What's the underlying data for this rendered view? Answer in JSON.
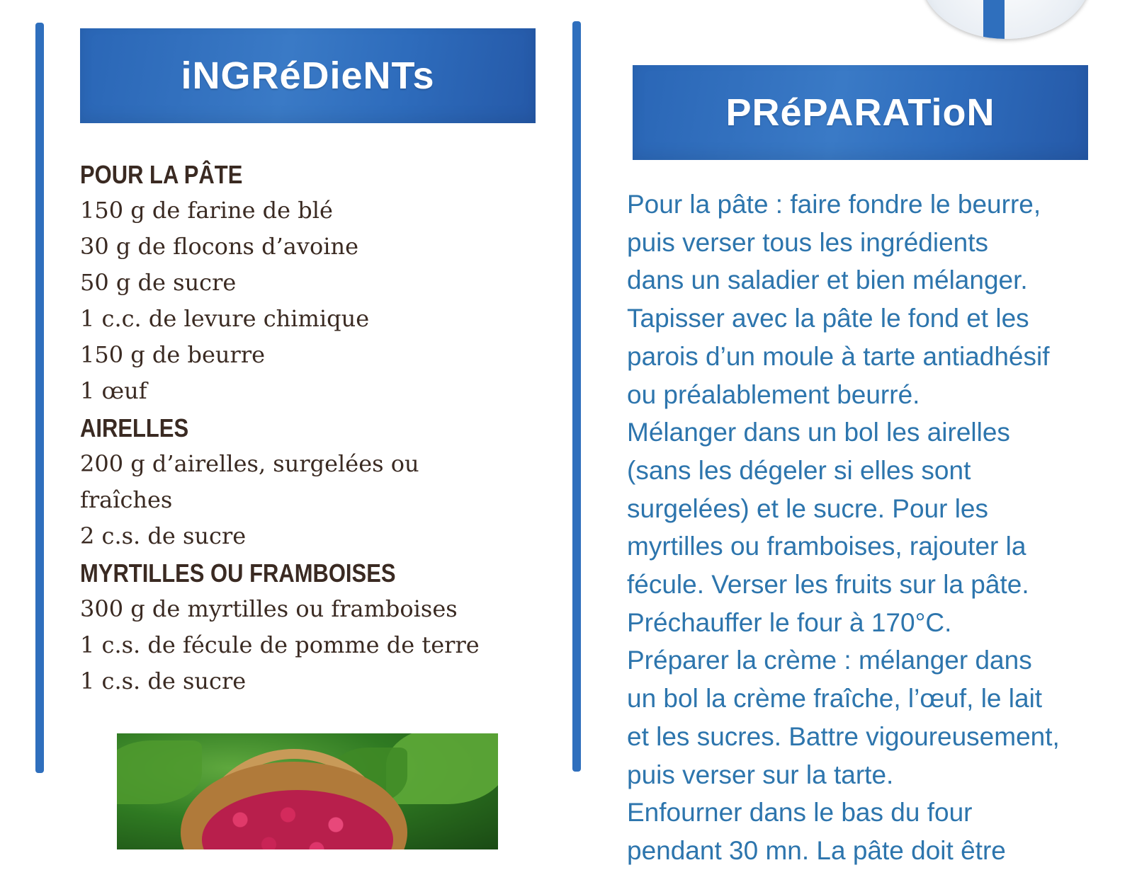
{
  "ingredients_banner": "iNGRéDieNTs",
  "preparation_banner": "PRéPARATioN",
  "ingredients": [
    {
      "title": "POUR LA PÂTE",
      "items": [
        "150 g de farine de blé",
        "30 g de flocons d’avoine",
        "50 g de sucre",
        "1 c.c. de levure chimique",
        "150 g de beurre",
        "1 œuf"
      ]
    },
    {
      "title": "AIRELLES",
      "items": [
        "200 g d’airelles, surgelées ou",
        "fraîches",
        "2 c.s. de sucre"
      ]
    },
    {
      "title": "MYRTILLES OU FRAMBOISES",
      "items": [
        "300 g de myrtilles ou framboises",
        "1 c.s. de fécule de pomme de terre",
        "1 c.s. de sucre"
      ]
    }
  ],
  "preparation_lines": [
    "Pour la pâte : faire fondre le beurre,",
    "puis verser tous les ingrédients",
    "dans un saladier et bien mélanger.",
    "Tapisser avec la pâte le fond et les",
    "parois d’un moule à tarte antiadhésif",
    "ou préalablement beurré.",
    "Mélanger dans un bol les airelles",
    "(sans les dégeler si elles sont",
    "surgelées) et le sucre. Pour les",
    "myrtilles ou framboises, rajouter la",
    "fécule. Verser les fruits sur la pâte.",
    "Préchauffer le four à 170°C.",
    "Préparer la crème : mélanger dans",
    "un bol la crème fraîche, l’œuf, le lait",
    "et les sucres. Battre vigoureusement,",
    "puis verser sur la tarte.",
    "Enfourner dans le bas du four",
    "pendant 30 mn. La pâte doit être"
  ],
  "colors": {
    "accent_blue": "#2f6fbd",
    "ingredient_text": "#3a2a22",
    "preparation_text": "#2d75ad"
  }
}
